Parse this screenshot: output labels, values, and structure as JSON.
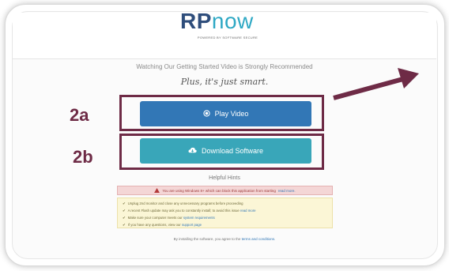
{
  "logo": {
    "rp": "RP",
    "now": "now",
    "tagline": "POWERED BY SOFTWARE SECURE"
  },
  "headline": "Watching Our Getting Started Video is Strongly Recommended",
  "subhead": "Plus, it's just smart.",
  "annotations": {
    "label_a": "2a",
    "label_b": "2b",
    "accent_color": "#6e2b46"
  },
  "buttons": {
    "play": {
      "label": "Play Video",
      "icon": "play-circle-icon",
      "color": "#3277b6"
    },
    "download": {
      "label": "Download Software",
      "icon": "cloud-download-icon",
      "color": "#39a6b9"
    }
  },
  "hints": {
    "title": "Helpful Hints",
    "warning": {
      "text": "You are using Windows 8+ which can block this application from starting",
      "link": "read more."
    },
    "tips": [
      {
        "text": "Unplug 2nd monitor and close any unnecessary programs before proceeding",
        "link": ""
      },
      {
        "text": "A recent Flash update may ask you to constantly install; to avoid this issue",
        "link": "read more"
      },
      {
        "text": "Make sure your computer meets our",
        "link": "system requirements"
      },
      {
        "text": "If you have any questions, view our",
        "link": "support page"
      }
    ]
  },
  "footer": {
    "text": "By installing the software, you agree to the",
    "link": "terms and conditions."
  }
}
